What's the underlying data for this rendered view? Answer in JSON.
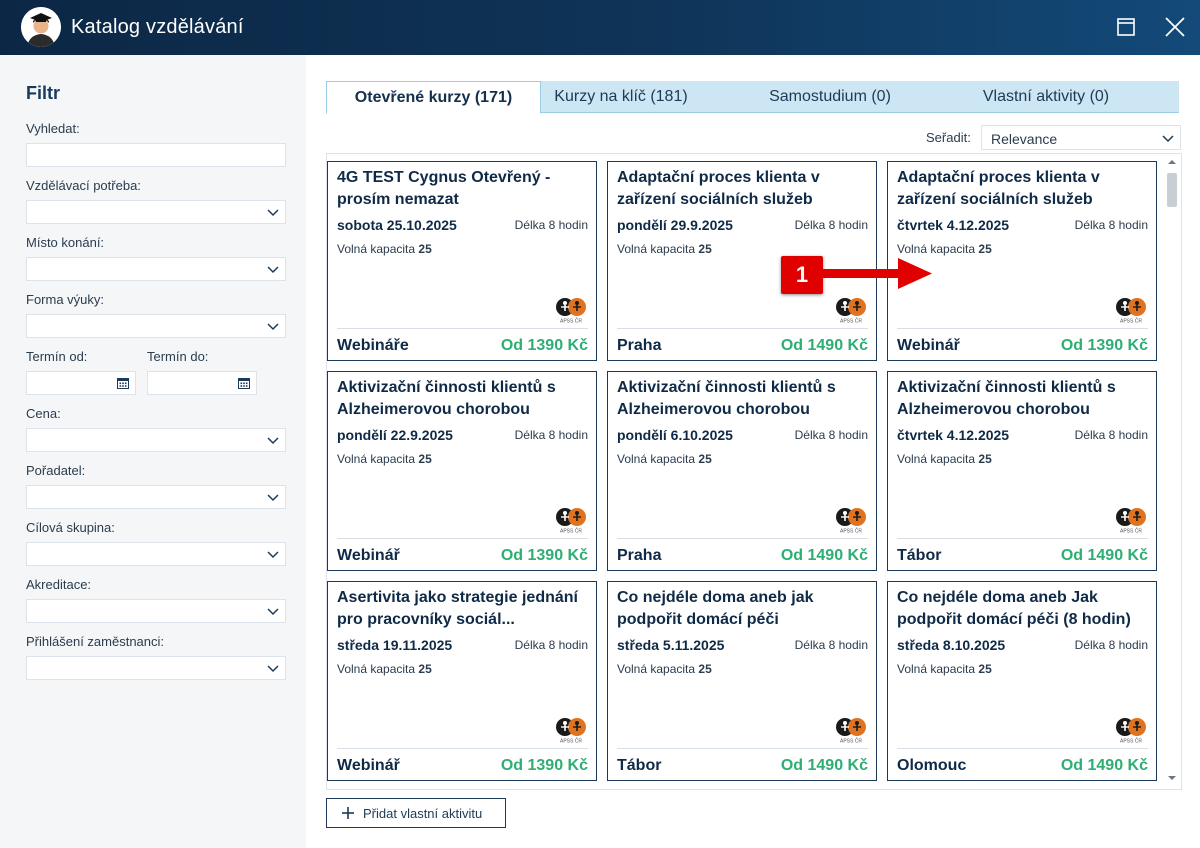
{
  "window": {
    "title": "Katalog vzdělávání"
  },
  "sidebar": {
    "title": "Filtr",
    "fields": {
      "search": "Vyhledat:",
      "need": "Vzdělávací potřeba:",
      "place": "Místo konání:",
      "form": "Forma výuky:",
      "date_from": "Termín od:",
      "date_to": "Termín do:",
      "price": "Cena:",
      "organizer": "Pořadatel:",
      "target": "Cílová skupina:",
      "accreditation": "Akreditace:",
      "employees": "Přihlášení zaměstnanci:"
    }
  },
  "tabs": [
    {
      "label": "Otevřené kurzy (171)",
      "active": true
    },
    {
      "label": "Kurzy na klíč (181)",
      "active": false
    },
    {
      "label": "Samostudium (0)",
      "active": false
    },
    {
      "label": "Vlastní aktivity (0)",
      "active": false
    }
  ],
  "sort": {
    "label": "Seřadit:",
    "value": "Relevance"
  },
  "cards": [
    {
      "title": "4G TEST Cygnus  Otevřený - prosím nemazat",
      "date": "sobota 25.10.2025",
      "length": "Délka 8 hodin",
      "capacity_label": "Volná kapacita",
      "capacity": "25",
      "place": "Webináře",
      "price": "Od 1390 Kč"
    },
    {
      "title": "Adaptační proces klienta v zařízení sociálních služeb",
      "date": "pondělí 29.9.2025",
      "length": "Délka 8 hodin",
      "capacity_label": "Volná kapacita",
      "capacity": "25",
      "place": "Praha",
      "price": "Od 1490 Kč"
    },
    {
      "title": "Adaptační proces klienta v zařízení sociálních služeb",
      "date": "čtvrtek 4.12.2025",
      "length": "Délka 8 hodin",
      "capacity_label": "Volná kapacita",
      "capacity": "25",
      "place": "Webinář",
      "price": "Od 1390 Kč"
    },
    {
      "title": "Aktivizační činnosti klientů s Alzheimerovou chorobou",
      "date": "pondělí 22.9.2025",
      "length": "Délka 8 hodin",
      "capacity_label": "Volná kapacita",
      "capacity": "25",
      "place": "Webinář",
      "price": "Od 1390 Kč"
    },
    {
      "title": "Aktivizační činnosti klientů s Alzheimerovou chorobou",
      "date": "pondělí 6.10.2025",
      "length": "Délka 8 hodin",
      "capacity_label": "Volná kapacita",
      "capacity": "25",
      "place": "Praha",
      "price": "Od 1490 Kč"
    },
    {
      "title": "Aktivizační činnosti klientů s Alzheimerovou chorobou",
      "date": "čtvrtek 4.12.2025",
      "length": "Délka 8 hodin",
      "capacity_label": "Volná kapacita",
      "capacity": "25",
      "place": "Tábor",
      "price": "Od 1490 Kč"
    },
    {
      "title": "Asertivita jako strategie jednání pro pracovníky sociál...",
      "date": "středa 19.11.2025",
      "length": "Délka 8 hodin",
      "capacity_label": "Volná kapacita",
      "capacity": "25",
      "place": "Webinář",
      "price": "Od 1390 Kč"
    },
    {
      "title": "Co nejdéle doma aneb jak podpořit domácí péči",
      "date": "středa 5.11.2025",
      "length": "Délka 8 hodin",
      "capacity_label": "Volná kapacita",
      "capacity": "25",
      "place": "Tábor",
      "price": "Od 1490 Kč"
    },
    {
      "title": "Co nejdéle doma aneb Jak podpořit domácí péči (8 hodin)",
      "date": "středa 8.10.2025",
      "length": "Délka 8 hodin",
      "capacity_label": "Volná kapacita",
      "capacity": "25",
      "place": "Olomouc",
      "price": "Od 1490 Kč"
    }
  ],
  "card_logo_text": "APSS ČR",
  "add_button": {
    "label": "Přidat vlastní aktivitu"
  },
  "callout": {
    "number": "1",
    "color": "#e00000"
  },
  "colors": {
    "title_bar": "#0f3458",
    "price_green": "#2eae72",
    "tab_bar": "#cde6f4"
  }
}
